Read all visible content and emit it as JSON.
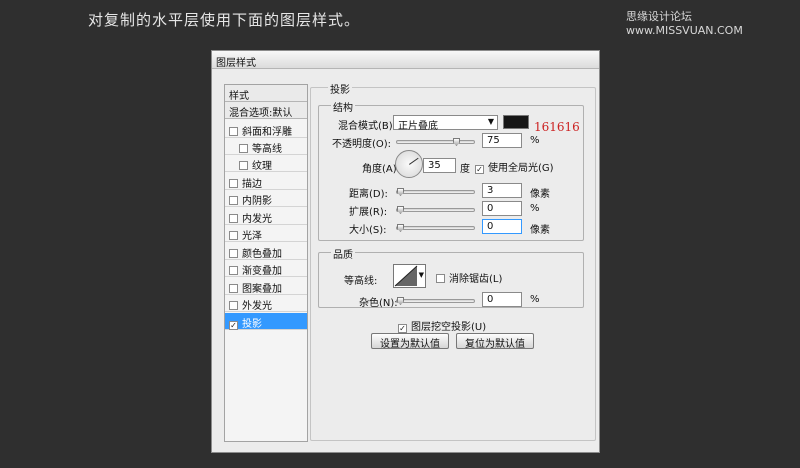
{
  "caption": "对复制的水平层使用下面的图层样式。",
  "watermark": "思缘设计论坛 www.MISSVUAN.COM",
  "dialog": {
    "title": "图层样式",
    "left_panel": {
      "header": "样式",
      "blend": "混合选项:默认",
      "items": [
        {
          "label": "斜面和浮雕",
          "checked": false
        },
        {
          "label": "等高线",
          "checked": false
        },
        {
          "label": "纹理",
          "checked": false
        },
        {
          "label": "描边",
          "checked": false
        },
        {
          "label": "内阴影",
          "checked": false
        },
        {
          "label": "内发光",
          "checked": false
        },
        {
          "label": "光泽",
          "checked": false
        },
        {
          "label": "颜色叠加",
          "checked": false
        },
        {
          "label": "渐变叠加",
          "checked": false
        },
        {
          "label": "图案叠加",
          "checked": false
        },
        {
          "label": "外发光",
          "checked": false
        },
        {
          "label": "投影",
          "checked": true
        }
      ]
    },
    "section_title": "投影",
    "structure": {
      "title": "结构",
      "blend_mode_label": "混合模式(B):",
      "blend_mode_value": "正片叠底",
      "color_hex": "161616",
      "color_swatch": "#161616",
      "opacity_label": "不透明度(O):",
      "opacity_value": "75",
      "opacity_unit": "%",
      "angle_label": "角度(A):",
      "angle_value": "35",
      "angle_unit": "度",
      "global_light_label": "使用全局光(G)",
      "global_light_checked": true,
      "distance_label": "距离(D):",
      "distance_value": "3",
      "distance_unit": "像素",
      "spread_label": "扩展(R):",
      "spread_value": "0",
      "spread_unit": "%",
      "size_label": "大小(S):",
      "size_value": "0",
      "size_unit": "像素"
    },
    "quality": {
      "title": "品质",
      "contour_label": "等高线:",
      "antialias_label": "消除锯齿(L)",
      "antialias_checked": false,
      "noise_label": "杂色(N):",
      "noise_value": "0",
      "noise_unit": "%"
    },
    "knockout_label": "图层挖空投影(U)",
    "knockout_checked": true,
    "set_default_label": "设置为默认值",
    "reset_default_label": "复位为默认值"
  }
}
